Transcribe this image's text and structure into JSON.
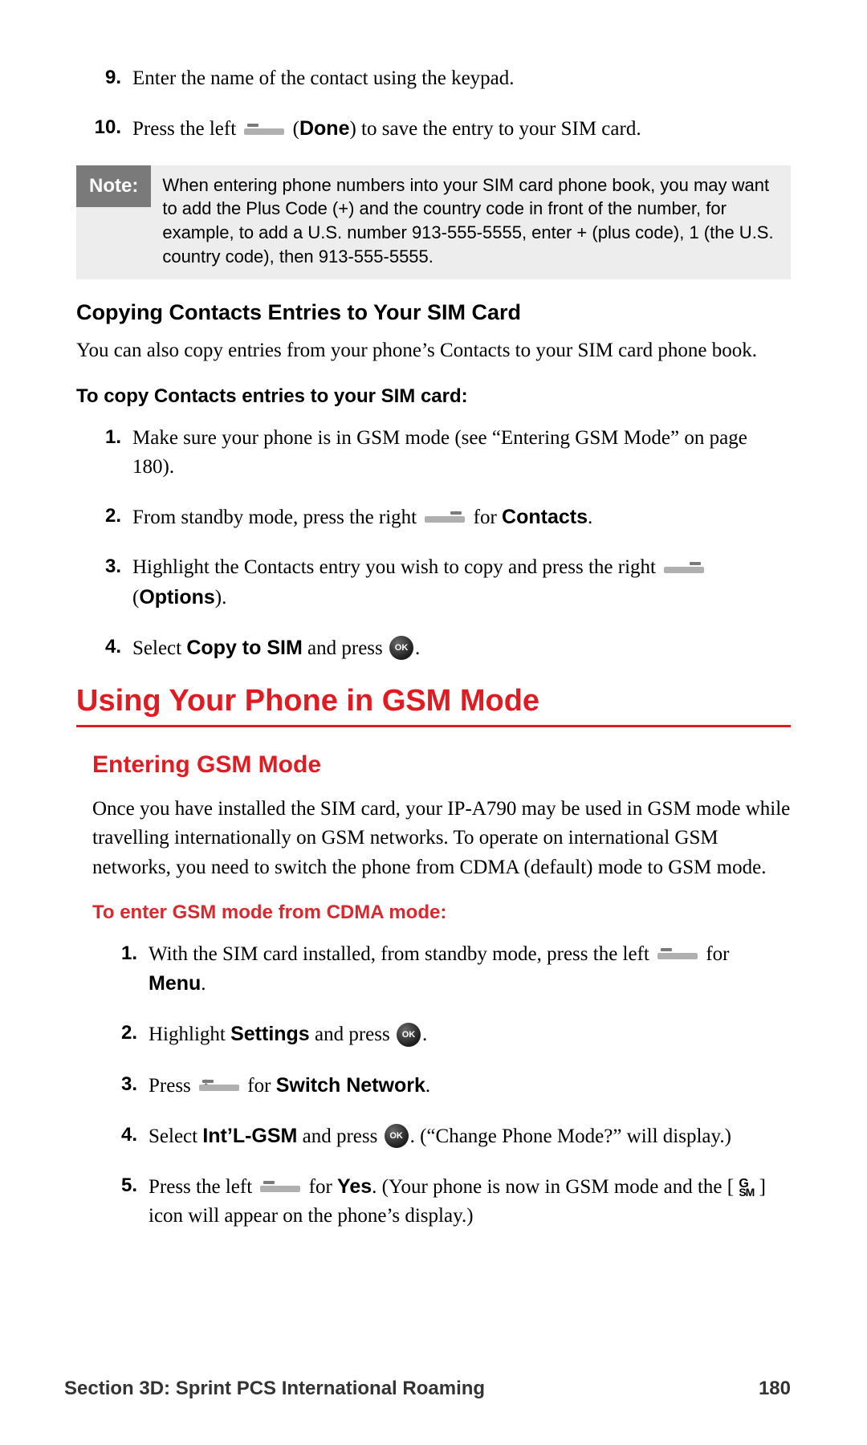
{
  "top_steps": [
    {
      "n": "9.",
      "parts": [
        "Enter the name of the contact using the keypad."
      ]
    },
    {
      "n": "10.",
      "parts": [
        "Press the left ",
        {
          "icon": "softkey-left"
        },
        " (",
        {
          "bold": "Done"
        },
        ") to save the entry to your SIM card."
      ]
    }
  ],
  "note": {
    "label": "Note:",
    "text": "When entering phone numbers into your SIM card phone book, you may want to add the Plus Code (+) and the country code in front of the number, for example, to add a U.S. number 913-555-5555, enter + (plus code), 1 (the U.S. country code), then 913-555-5555."
  },
  "copying": {
    "heading": "Copying Contacts Entries to Your SIM Card",
    "body": "You can also copy entries from your phone’s Contacts to your SIM card phone book.",
    "lead": "To copy Contacts entries to your SIM card:",
    "steps": [
      {
        "n": "1.",
        "parts": [
          "Make sure your phone is in GSM mode (see “Entering GSM Mode” on page 180)."
        ]
      },
      {
        "n": "2.",
        "parts": [
          "From standby mode, press the right ",
          {
            "icon": "softkey-right"
          },
          " for ",
          {
            "bold": "Contacts"
          },
          "."
        ]
      },
      {
        "n": "3.",
        "parts": [
          "Highlight the Contacts entry you wish to copy and press the right ",
          {
            "icon": "softkey-right"
          },
          " (",
          {
            "bold": "Options"
          },
          ")."
        ]
      },
      {
        "n": "4.",
        "parts": [
          "Select ",
          {
            "bold": "Copy to SIM"
          },
          " and press ",
          {
            "icon": "ok"
          },
          "."
        ]
      }
    ]
  },
  "gsm": {
    "heading1": "Using Your Phone in GSM Mode",
    "heading2": "Entering GSM Mode",
    "body": "Once you have installed the SIM card, your IP-A790 may be used in GSM mode while travelling internationally on GSM networks. To operate on international GSM networks, you need to switch the phone from CDMA (default) mode to GSM mode.",
    "lead": "To enter GSM mode from CDMA mode:",
    "steps": [
      {
        "n": "1.",
        "parts": [
          "With the SIM card installed, from standby mode, press the left ",
          {
            "icon": "softkey-left"
          },
          " for ",
          {
            "bold": "Menu"
          },
          "."
        ]
      },
      {
        "n": "2.",
        "parts": [
          "Highlight ",
          {
            "bold": "Settings"
          },
          " and press ",
          {
            "icon": "ok"
          },
          "."
        ]
      },
      {
        "n": "3.",
        "parts": [
          "Press ",
          {
            "icon": "softkey-num1"
          },
          " for ",
          {
            "bold": "Switch Network"
          },
          "."
        ]
      },
      {
        "n": "4.",
        "parts": [
          "Select ",
          {
            "bold": "Int’L-GSM"
          },
          " and press ",
          {
            "icon": "ok"
          },
          ". (“Change Phone Mode?” will display.)"
        ]
      },
      {
        "n": "5.",
        "parts": [
          "Press the left ",
          {
            "icon": "softkey-left"
          },
          " for ",
          {
            "bold": "Yes"
          },
          ". (Your phone is now in GSM mode and the [ ",
          {
            "icon": "gsm-glyph"
          },
          " ] icon will appear on the phone’s display.)"
        ]
      }
    ]
  },
  "footer": {
    "section": "Section 3D: Sprint PCS International Roaming",
    "page": "180"
  },
  "icons": {
    "ok_label": "OK"
  }
}
